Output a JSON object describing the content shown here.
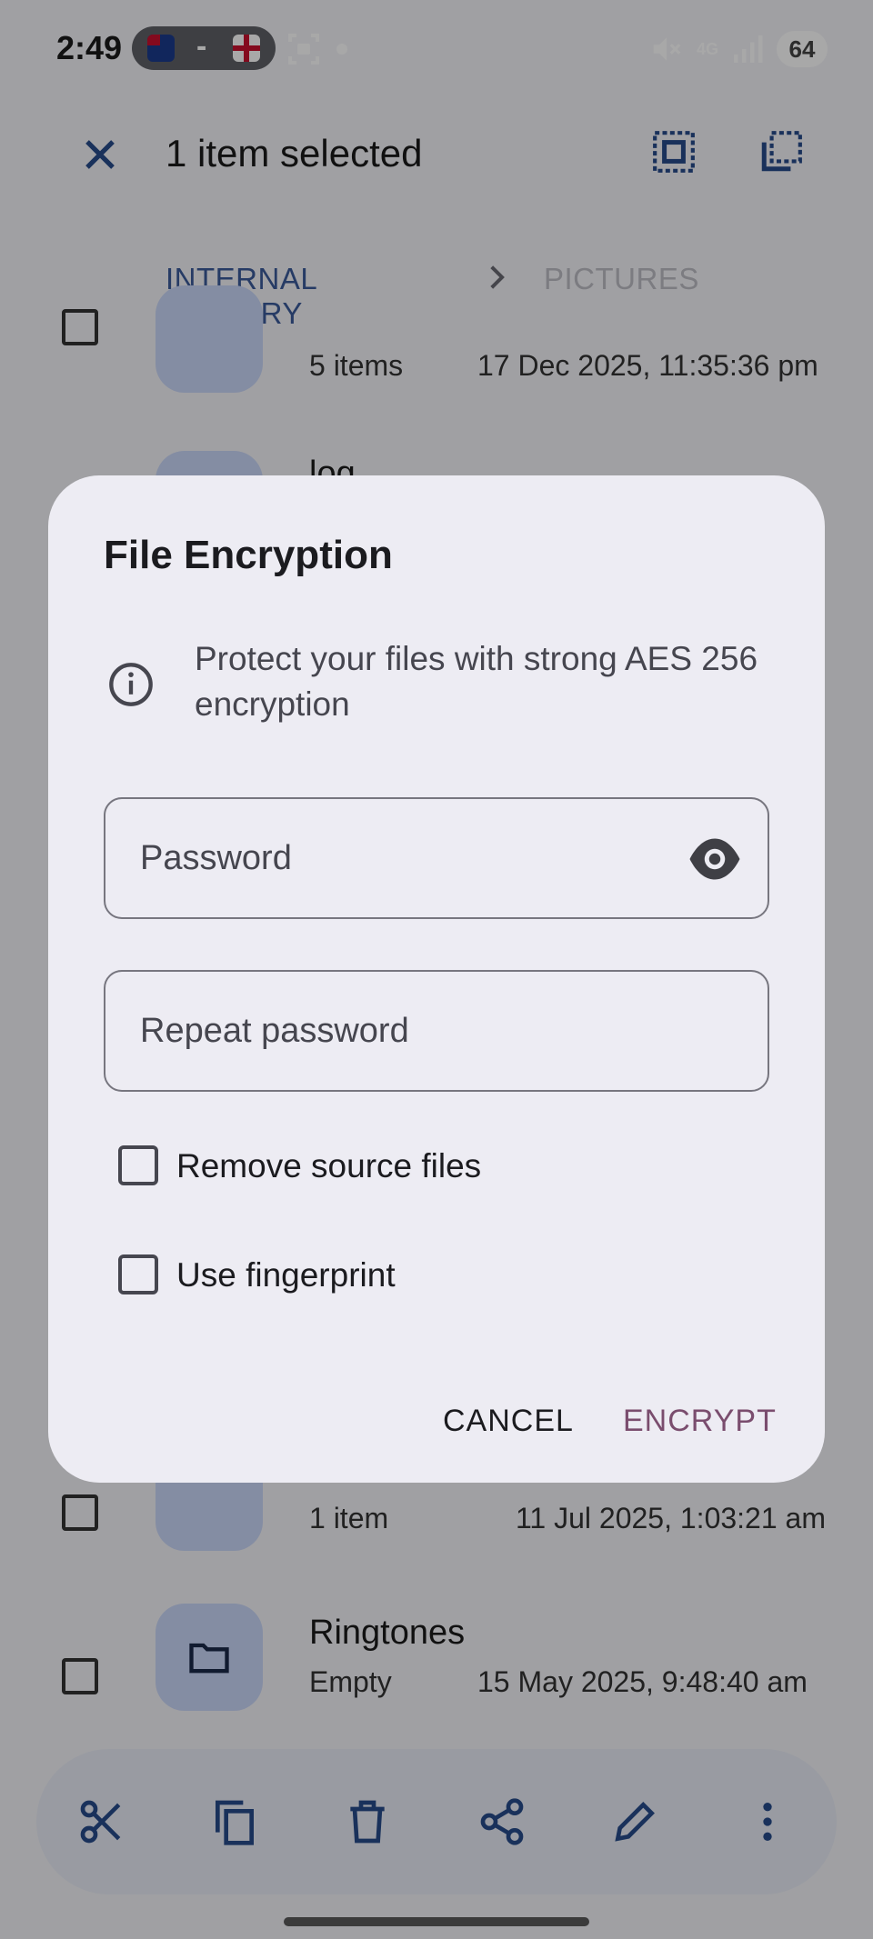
{
  "status_bar": {
    "time": "2:49",
    "flag_separator": "-",
    "network": "4G",
    "battery": "64"
  },
  "app_bar": {
    "title": "1 item selected",
    "breadcrumb": [
      "INTERNAL MEMORY",
      "PICTURES"
    ]
  },
  "file_list": [
    {
      "name": "",
      "meta": "5 items",
      "date": "17 Dec 2025, 11:35:36 pm"
    },
    {
      "name": "log",
      "meta": "",
      "date": ""
    },
    {
      "name": "",
      "meta": "1 item",
      "date": "11 Jul 2025, 1:03:21 am"
    },
    {
      "name": "Ringtones",
      "meta": "Empty",
      "date": "15 May 2025, 9:48:40 am"
    }
  ],
  "bottom_actions": [
    "cut-icon",
    "copy-icon",
    "delete-icon",
    "share-icon",
    "rename-icon",
    "more-icon"
  ],
  "dialog": {
    "title": "File Encryption",
    "description": "Protect your files with strong AES 256 encryption",
    "password_placeholder": "Password",
    "password_value": "",
    "repeat_placeholder": "Repeat password",
    "repeat_value": "",
    "remove_source_label": "Remove source files",
    "remove_source_checked": false,
    "fingerprint_label": "Use fingerprint",
    "fingerprint_checked": false,
    "cancel_label": "CANCEL",
    "encrypt_label": "ENCRYPT",
    "accent_color": "#7a4d6e"
  }
}
